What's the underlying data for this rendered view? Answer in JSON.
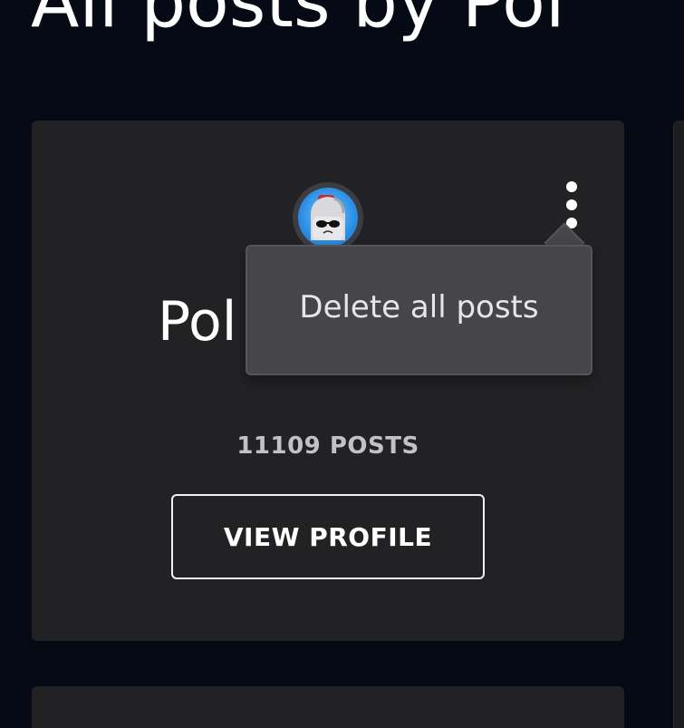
{
  "page": {
    "title": "All posts by Pol"
  },
  "user_card": {
    "username": "Pol",
    "post_count": "11109 POSTS",
    "view_profile_label": "VIEW PROFILE",
    "avatar_alt": "user avatar"
  },
  "menu": {
    "icon": "kebab-menu-icon",
    "items": [
      {
        "label": "Delete all posts"
      }
    ]
  },
  "colors": {
    "background": "#050a14",
    "card": "#222224",
    "popover": "#464648",
    "avatar_bg": "#2b8fe4"
  }
}
